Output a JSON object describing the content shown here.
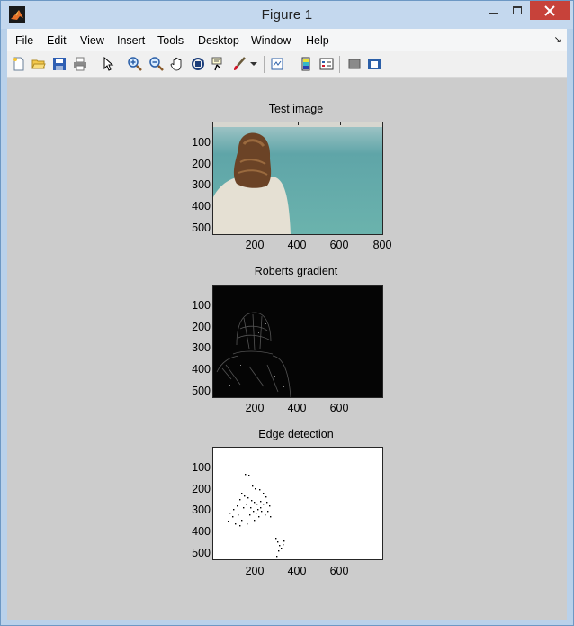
{
  "window": {
    "title": "Figure 1"
  },
  "menu": [
    "File",
    "Edit",
    "View",
    "Insert",
    "Tools",
    "Desktop",
    "Window",
    "Help"
  ],
  "toolbar": {
    "tools": [
      "new-figure-icon",
      "open-file-icon",
      "save-icon",
      "print-icon",
      "edit-plot-arrow-icon",
      "zoom-in-icon",
      "zoom-out-icon",
      "pan-hand-icon",
      "rotate-3d-icon",
      "data-cursor-icon",
      "brush-icon",
      "link-plot-icon",
      "insert-colorbar-icon",
      "insert-legend-icon",
      "hide-plot-tools-icon",
      "show-plot-tools-icon"
    ]
  },
  "plots": [
    {
      "title": "Test image",
      "yticks": [
        "100",
        "200",
        "300",
        "400",
        "500"
      ],
      "xticks": [
        "200",
        "400",
        "600",
        "800"
      ],
      "content": "photo"
    },
    {
      "title": "Roberts gradient",
      "yticks": [
        "100",
        "200",
        "300",
        "400",
        "500"
      ],
      "xticks": [
        "200",
        "400",
        "600"
      ],
      "content": "gradient"
    },
    {
      "title": "Edge detection",
      "yticks": [
        "100",
        "200",
        "300",
        "400",
        "500"
      ],
      "xticks": [
        "200",
        "400",
        "600"
      ],
      "content": "edges"
    }
  ],
  "colors": {
    "titlebar": "#c4d8ee",
    "close_button": "#c7423a",
    "figure_background": "#cccccc"
  }
}
